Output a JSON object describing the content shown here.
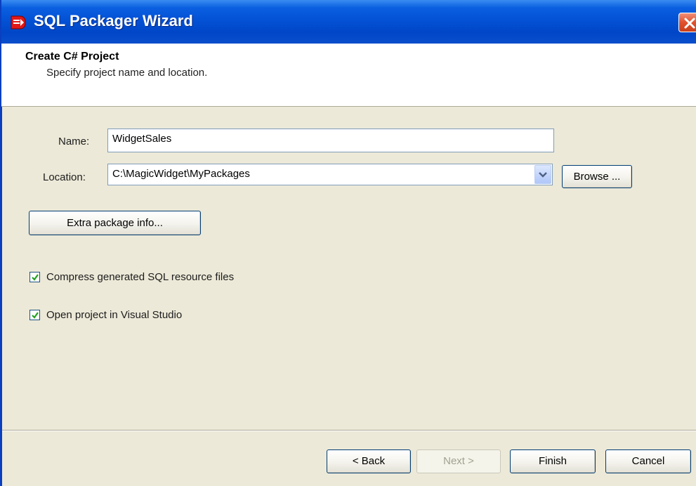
{
  "window": {
    "title": "SQL Packager Wizard"
  },
  "header": {
    "title": "Create C# Project",
    "subtitle": "Specify project name and location."
  },
  "form": {
    "name_label": "Name:",
    "name_value": "WidgetSales",
    "location_label": "Location:",
    "location_value": "C:\\MagicWidget\\MyPackages",
    "browse_label": "Browse ...",
    "extra_info_label": "Extra package info...",
    "compress_label": "Compress generated SQL resource files",
    "compress_checked": true,
    "open_vs_label": "Open project in Visual Studio",
    "open_vs_checked": true
  },
  "footer": {
    "back_label": "< Back",
    "next_label": "Next >",
    "finish_label": "Finish",
    "cancel_label": "Cancel"
  },
  "colors": {
    "titlebar": "#0452d6",
    "dialog_bg": "#ece9d8",
    "close_button": "#e0502c",
    "checkbox_mark": "#21a121"
  },
  "icons": {
    "app": "sql-packager-app-icon",
    "close": "close-x-icon",
    "dropdown": "chevron-down-icon",
    "check": "checkmark-icon"
  }
}
